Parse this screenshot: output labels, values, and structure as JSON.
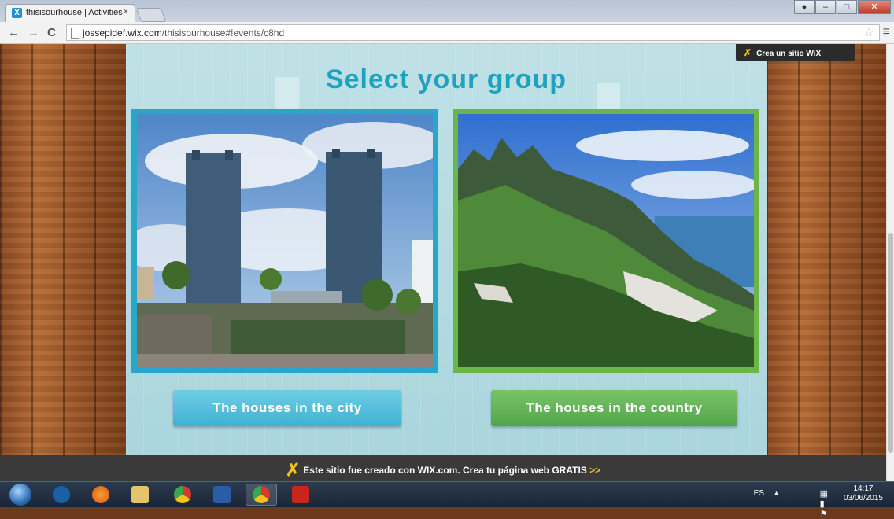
{
  "browser": {
    "tab_title": "thisisourhouse | Activities",
    "tab_close": "×",
    "url_host": "jossepidef.wix.com",
    "url_path": "/thisisourhouse#!events/c8hd"
  },
  "page": {
    "title": "Select your group",
    "groups": [
      {
        "label": "The houses in the city"
      },
      {
        "label": "The houses in the country"
      }
    ],
    "wix_badge": "Crea un sitio WiX",
    "wix_banner": "Este sitio fue creado con WIX.com. Crea tu página web GRATIS",
    "wix_banner_arrows": ">>"
  },
  "taskbar": {
    "language": "ES",
    "time": "14:17",
    "date": "03/06/2015"
  },
  "colors": {
    "title": "#1fa2bf",
    "city_frame": "#29a6c9",
    "country_frame": "#6bb549",
    "wix_yellow": "#f6c31d"
  }
}
